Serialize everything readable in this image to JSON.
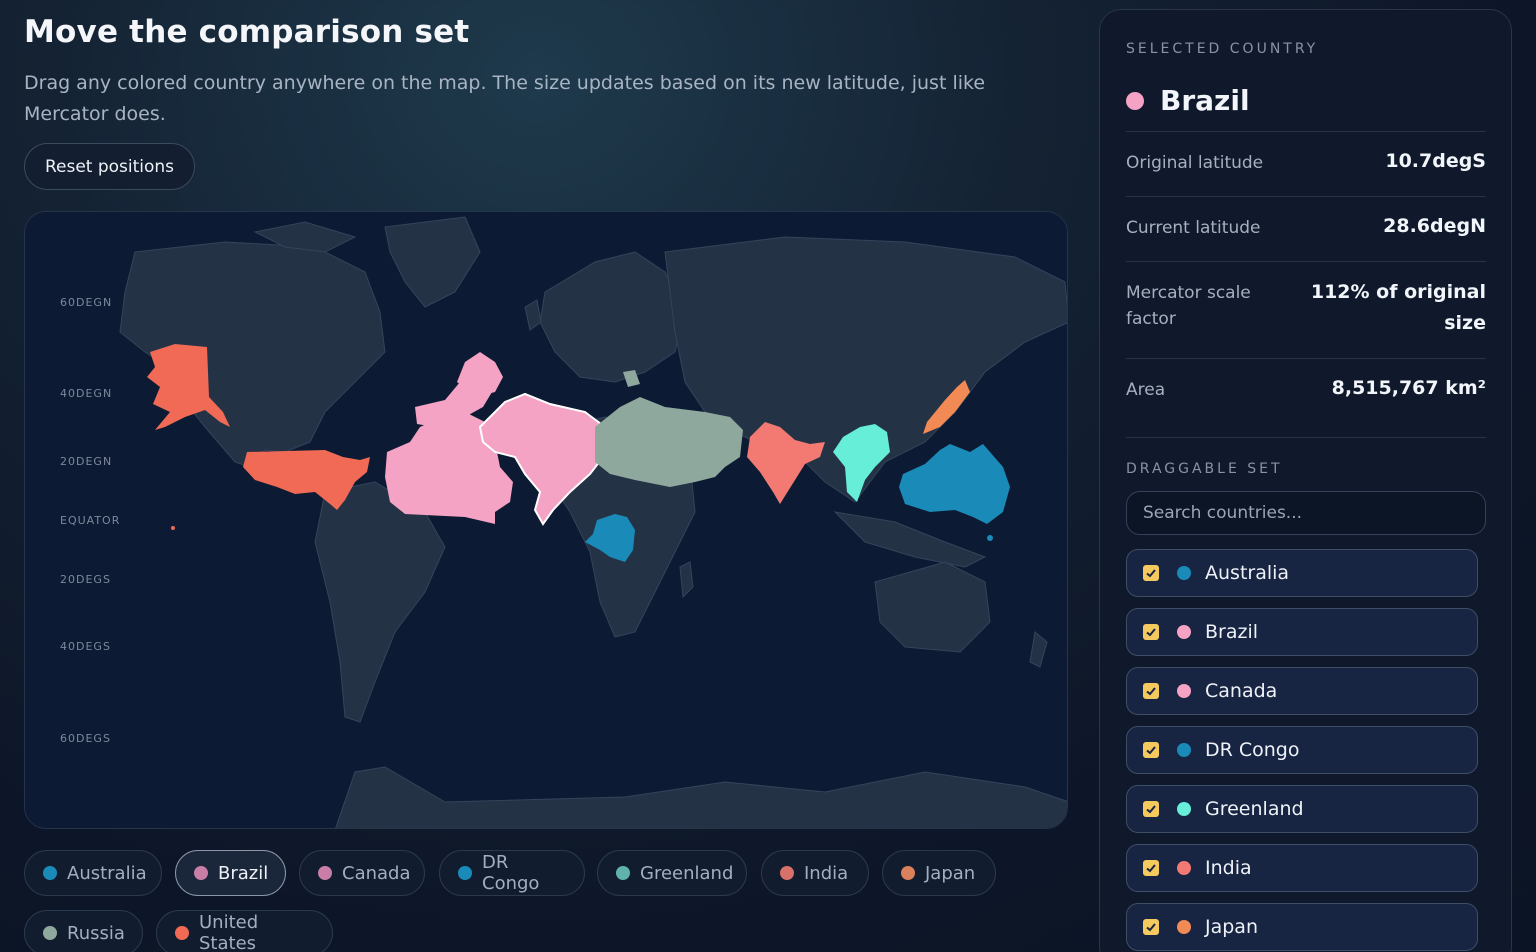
{
  "page": {
    "title": "Move the comparison set",
    "subtitle": "Drag any colored country anywhere on the map. The size updates based on its new latitude, just like Mercator does.",
    "reset_label": "Reset positions"
  },
  "map": {
    "latitude_labels": [
      "60DEGN",
      "40DEGN",
      "20DEGN",
      "EQUATOR",
      "20DEGS",
      "40DEGS",
      "60DEGS"
    ]
  },
  "chips": [
    {
      "label": "Australia",
      "color": "#1a8bb8",
      "active": false
    },
    {
      "label": "Brazil",
      "color": "#c97ea8",
      "active": true
    },
    {
      "label": "Canada",
      "color": "#c97ea8",
      "active": false
    },
    {
      "label": "DR Congo",
      "color": "#1a8bb8",
      "active": false
    },
    {
      "label": "Greenland",
      "color": "#5fb3aa",
      "active": false
    },
    {
      "label": "India",
      "color": "#d9716b",
      "active": false
    },
    {
      "label": "Japan",
      "color": "#d9805d",
      "active": false
    },
    {
      "label": "Russia",
      "color": "#8fa89e",
      "active": false
    },
    {
      "label": "United States",
      "color": "#f06a55",
      "active": false
    }
  ],
  "selected": {
    "heading": "SELECTED COUNTRY",
    "name": "Brazil",
    "color": "#f4a3c4",
    "rows": [
      {
        "key": "Original latitude",
        "value": "10.7degS"
      },
      {
        "key": "Current latitude",
        "value": "28.6degN"
      },
      {
        "key": "Mercator scale factor",
        "value": "112% of original size"
      },
      {
        "key": "Area",
        "value": "8,515,767 km²"
      }
    ]
  },
  "draggable": {
    "heading": "DRAGGABLE SET",
    "search_placeholder": "Search countries...",
    "items": [
      {
        "label": "Australia",
        "color": "#1a8bb8",
        "checked": true
      },
      {
        "label": "Brazil",
        "color": "#f4a3c4",
        "checked": true
      },
      {
        "label": "Canada",
        "color": "#f4a3c4",
        "checked": true
      },
      {
        "label": "DR Congo",
        "color": "#1a8bb8",
        "checked": true
      },
      {
        "label": "Greenland",
        "color": "#66eed8",
        "checked": true
      },
      {
        "label": "India",
        "color": "#f27a72",
        "checked": true
      },
      {
        "label": "Japan",
        "color": "#f28a55",
        "checked": true
      }
    ]
  },
  "colors": {
    "australia": "#1a8bb8",
    "brazil": "#f4a3c4",
    "canada": "#f4a3c4",
    "drcongo": "#1a8bb8",
    "greenland": "#66eed8",
    "india": "#f27a72",
    "japan": "#f28a55",
    "russia": "#8fa89e",
    "united_states": "#f06a55",
    "land": "#243246",
    "ocean": "#0d1a33"
  }
}
